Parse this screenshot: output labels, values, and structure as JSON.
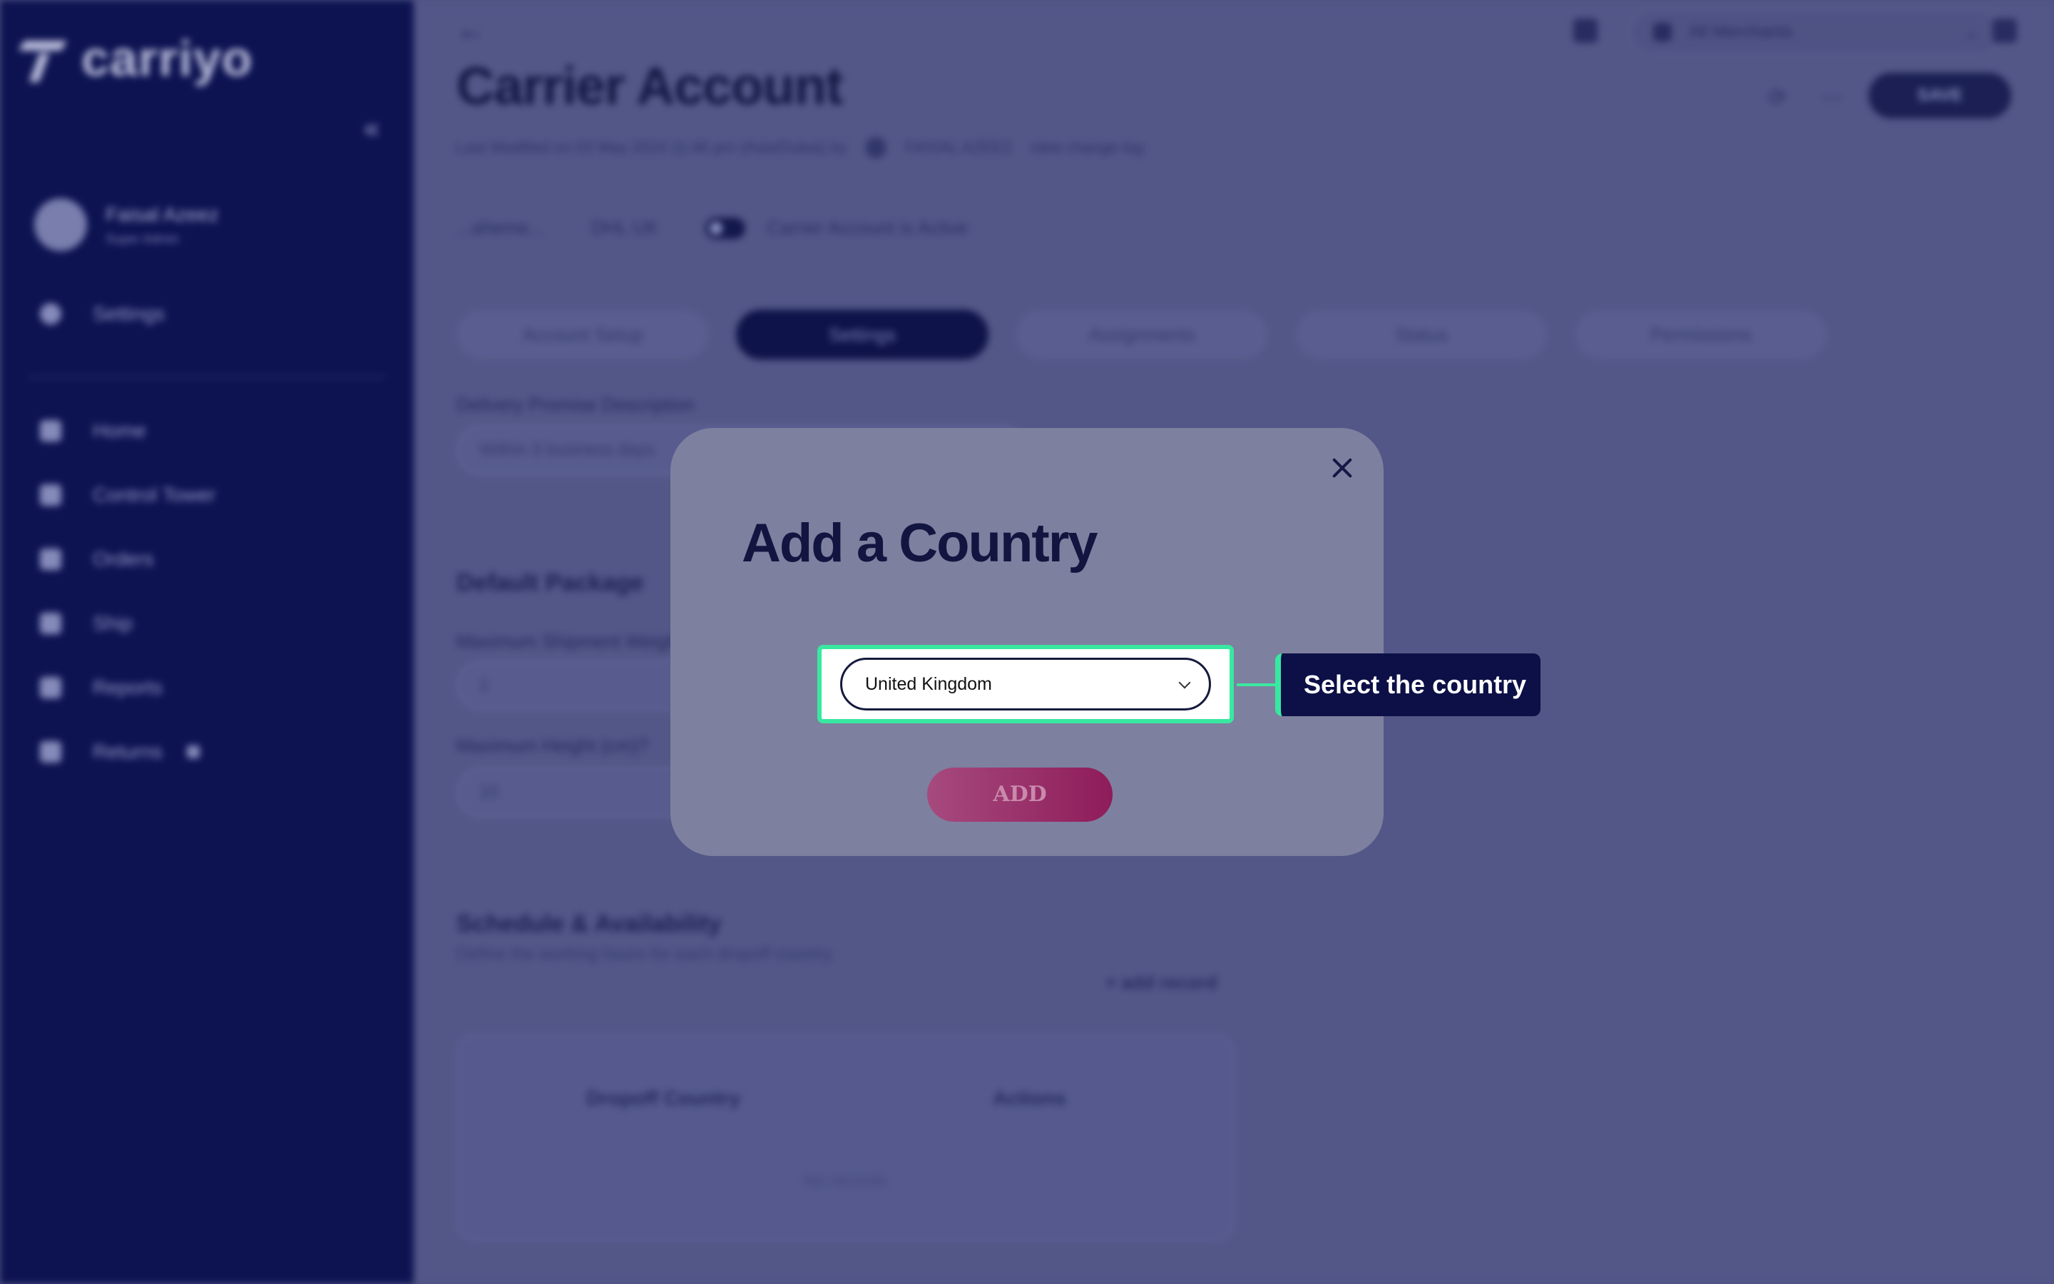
{
  "sidebar": {
    "logo_text": "carriyo",
    "user": {
      "name": "Faisal Azeez",
      "role": "Super Admin"
    },
    "settings_label": "Settings",
    "nav": [
      {
        "label": "Home",
        "icon": "home-icon"
      },
      {
        "label": "Control Tower",
        "icon": "grid-icon"
      },
      {
        "label": "Orders",
        "icon": "cart-icon"
      },
      {
        "label": "Ship",
        "icon": "ship-icon"
      },
      {
        "label": "Reports",
        "icon": "chart-icon"
      },
      {
        "label": "Returns",
        "icon": "returns-icon"
      }
    ]
  },
  "header": {
    "merchant_select": "All Merchants",
    "page_title": "Carrier Account",
    "modified_text": "Last Modified on 03 May 2024 11:46 pm (Asia/Dubai) by",
    "modified_by": "FAISAL AZEEZ",
    "change_log": "view change log",
    "save_label": "SAVE"
  },
  "meta": {
    "account_id": "...aheme...",
    "carrier_name": "DHL UK",
    "active_label": "Carrier Account is Active"
  },
  "tabs": [
    "Account Setup",
    "Settings",
    "Assignments",
    "Status",
    "Permissions"
  ],
  "form": {
    "delivery_promise_label": "Delivery Promise Description",
    "delivery_promise_value": "Within 3 business days",
    "default_package_title": "Default Package",
    "max_weight_label": "Maximum Shipment Weight",
    "max_weight_value": "1",
    "max_height_label": "Maximum Height (cm)?",
    "max_height_value": "10"
  },
  "schedule": {
    "title": "Schedule & Availability",
    "subtitle": "Define the working hours for each dropoff country.",
    "add_record": "+ add record",
    "columns": [
      "Dropoff Country",
      "Actions"
    ],
    "empty_text": "No records"
  },
  "modal": {
    "title": "Add a Country",
    "selected_country": "United Kingdom",
    "add_button": "ADD"
  },
  "tooltip": {
    "text": "Select the country"
  },
  "colors": {
    "highlight": "#39e8a0",
    "navy": "#0c1046",
    "add_button": "#8e1c5a"
  }
}
